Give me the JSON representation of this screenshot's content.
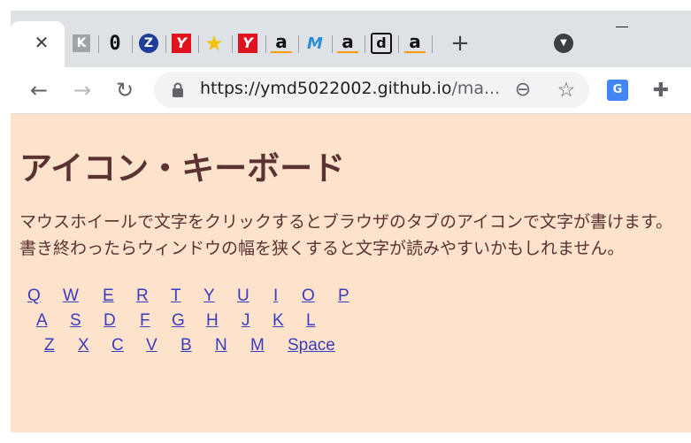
{
  "browser": {
    "close_tab_glyph": "✕",
    "pinned_tabs": [
      {
        "icon": "k-arrow-icon",
        "glyph": "K"
      },
      {
        "icon": "zero-icon",
        "glyph": "0"
      },
      {
        "icon": "z-circle-icon",
        "glyph": "Z"
      },
      {
        "icon": "y-red-icon",
        "glyph": "Y"
      },
      {
        "icon": "star-icon",
        "glyph": "★"
      },
      {
        "icon": "y-red-icon",
        "glyph": "Y"
      },
      {
        "icon": "amazon-icon",
        "glyph": "a"
      },
      {
        "icon": "m-icon",
        "glyph": "M"
      },
      {
        "icon": "amazon-icon",
        "glyph": "a"
      },
      {
        "icon": "d-icon",
        "glyph": "d"
      },
      {
        "icon": "amazon-icon",
        "glyph": "a"
      }
    ],
    "new_tab_glyph": "+",
    "tab_search_glyph": "▼",
    "back_glyph": "←",
    "forward_glyph": "→",
    "reload_glyph": "↻",
    "url_main": "https://ymd5022002.github.io",
    "url_rest": "/ma...",
    "zoom_glyph": "⊖",
    "bookmark_glyph": "☆",
    "translate_glyph": "G",
    "extensions_glyph": "✚"
  },
  "page": {
    "title": "アイコン・キーボード",
    "paragraph_lines": [
      "マウスホイールで文字をクリックするとブラウザのタブのアイコンで文字が書けます。",
      "書き終わったらウィンドウの幅を狭くすると文字が読みやすいかもしれません。"
    ],
    "keyboard_rows": [
      [
        "Q",
        "W",
        "E",
        "R",
        "T",
        "Y",
        "U",
        "I",
        "O",
        "P"
      ],
      [
        "A",
        "S",
        "D",
        "F",
        "G",
        "H",
        "J",
        "K",
        "L"
      ],
      [
        "Z",
        "X",
        "C",
        "V",
        "B",
        "N",
        "M",
        "Space"
      ]
    ]
  },
  "colors": {
    "page_bg": "#fde2cc",
    "text": "#5a3232",
    "link": "#3b3bbd",
    "tabstrip": "#dee1e6"
  }
}
